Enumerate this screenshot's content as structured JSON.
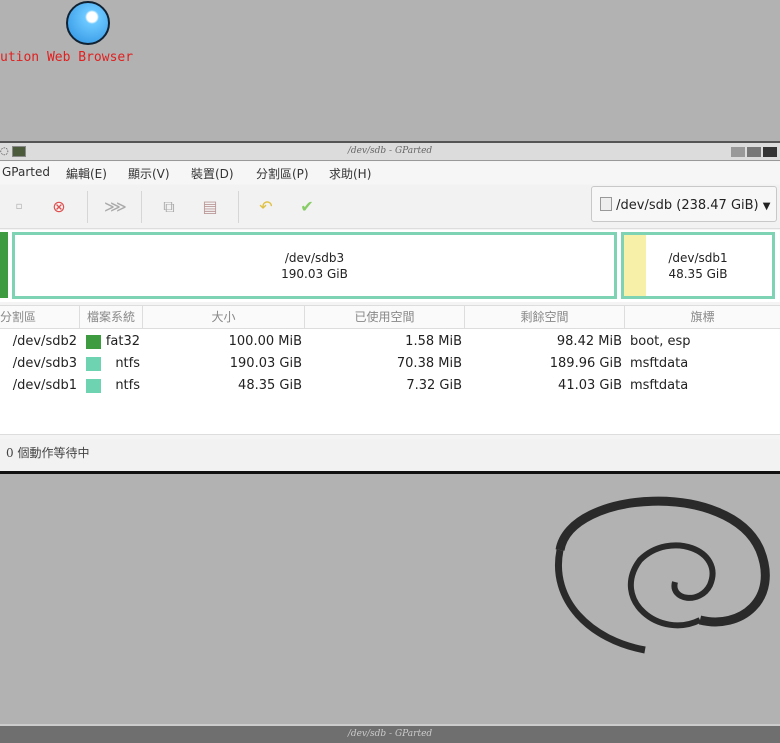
{
  "desktop": {
    "browser_label": "ution Web Browser",
    "taskbar_title": "/dev/sdb - GParted"
  },
  "window": {
    "title": "/dev/sdb - GParted"
  },
  "menu": [
    "GParted",
    "編輯(E)",
    "顯示(V)",
    "裝置(D)",
    "分割區(P)",
    "求助(H)"
  ],
  "toolbar": {
    "device": "/dev/sdb (238.47 GiB)"
  },
  "map": [
    {
      "name": "/dev/sdb3",
      "size": "190.03 GiB"
    },
    {
      "name": "/dev/sdb1",
      "size": "48.35 GiB"
    }
  ],
  "table": {
    "headers": [
      "分割區",
      "檔案系統",
      "大小",
      "已使用空間",
      "剩餘空間",
      "旗標"
    ],
    "rows": [
      {
        "partition": "/dev/sdb2",
        "fs": "fat32",
        "fs_color": "#3f9b3f",
        "size": "100.00 MiB",
        "used": "1.58 MiB",
        "unused": "98.42 MiB",
        "flags": "boot, esp"
      },
      {
        "partition": "/dev/sdb3",
        "fs": "ntfs",
        "fs_color": "#6dd3b0",
        "size": "190.03 GiB",
        "used": "70.38 MiB",
        "unused": "189.96 GiB",
        "flags": "msftdata"
      },
      {
        "partition": "/dev/sdb1",
        "fs": "ntfs",
        "fs_color": "#6dd3b0",
        "size": "48.35 GiB",
        "used": "7.32 GiB",
        "unused": "41.03 GiB",
        "flags": "msftdata"
      }
    ]
  },
  "status": "0  個動作等待中"
}
